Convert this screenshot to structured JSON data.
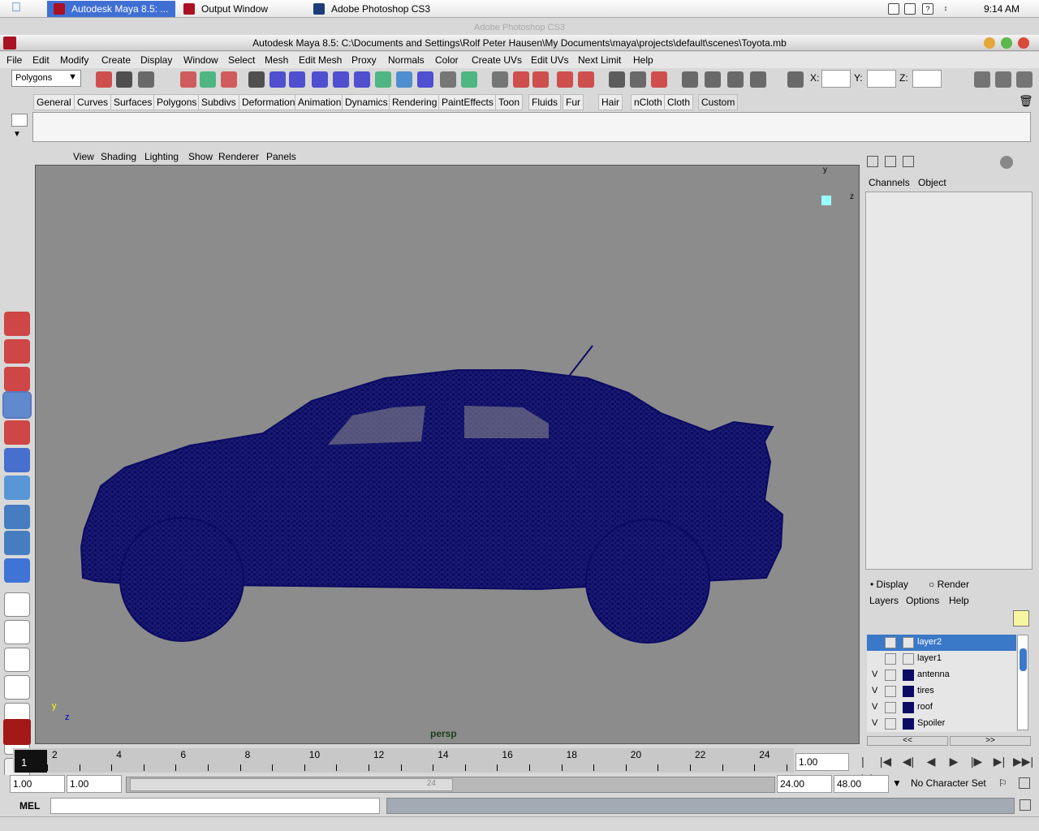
{
  "mac": {
    "tabs": [
      {
        "label": "Autodesk Maya 8.5: ..."
      },
      {
        "label": "Output Window"
      },
      {
        "label": "Adobe Photoshop CS3"
      }
    ],
    "clock": "9:14 AM"
  },
  "window": {
    "ghost_title": "Adobe Photoshop CS3",
    "title": "Autodesk Maya 8.5: C:\\Documents and Settings\\Rolf Peter Hausen\\My Documents\\maya\\projects\\default\\scenes\\Toyota.mb"
  },
  "menubar": [
    "File",
    "Edit",
    "Modify",
    "Create",
    "Display",
    "Window",
    "Select",
    "Mesh",
    "Edit Mesh",
    "Proxy",
    "Normals",
    "Color",
    "Create UVs",
    "Edit UVs",
    "Next Limit",
    "Help"
  ],
  "toolbar": {
    "mode": "Polygons",
    "x_label": "X:",
    "y_label": "Y:",
    "z_label": "Z:"
  },
  "shelf_tabs": [
    "General",
    "Curves",
    "Surfaces",
    "Polygons",
    "Subdivs",
    "Deformation",
    "Animation",
    "Dynamics",
    "Rendering",
    "PaintEffects",
    "Toon",
    "Fluids",
    "Fur",
    "Hair",
    "nCloth",
    "Cloth",
    "Custom"
  ],
  "viewport": {
    "menu": [
      "View",
      "Shading",
      "Lighting",
      "Show",
      "Renderer",
      "Panels"
    ],
    "camera": "persp",
    "axis_y": "y",
    "axis_z": "z",
    "mesh_color": "#0b0b63"
  },
  "channel_box": {
    "tabs": [
      "Channels",
      "Object"
    ]
  },
  "layer_editor": {
    "radio_display": "Display",
    "radio_render": "Render",
    "menu": [
      "Layers",
      "Options",
      "Help"
    ],
    "layers": [
      {
        "v": "",
        "name": "layer2"
      },
      {
        "v": "",
        "name": "layer1"
      },
      {
        "v": "V",
        "name": "antenna"
      },
      {
        "v": "V",
        "name": "tires"
      },
      {
        "v": "V",
        "name": "roof"
      },
      {
        "v": "V",
        "name": "Spoiler"
      }
    ],
    "scroll_left": "<<",
    "scroll_right": ">>"
  },
  "timeline": {
    "current_frame": "1",
    "ticks": [
      "2",
      "4",
      "6",
      "8",
      "10",
      "12",
      "14",
      "16",
      "18",
      "20",
      "22",
      "24"
    ],
    "current_time": "1.00"
  },
  "range": {
    "start": "1.00",
    "playback_start": "1.00",
    "slider_label": "24",
    "playback_end": "24.00",
    "end": "48.00",
    "character_set": "No Character Set"
  },
  "mel": {
    "label": "MEL"
  }
}
